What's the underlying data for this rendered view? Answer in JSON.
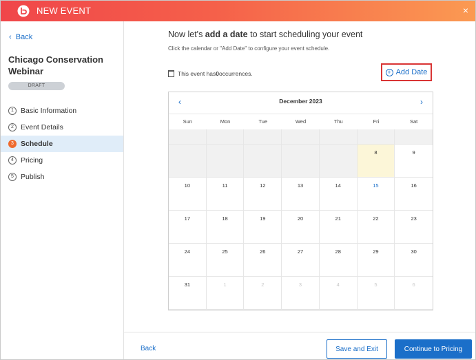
{
  "window": {
    "title": "NEW EVENT",
    "close_glyph": "×"
  },
  "sidebar": {
    "back_label": "Back",
    "event_title": "Chicago Conservation Webinar",
    "status_badge": "DRAFT",
    "steps": [
      {
        "num": "1",
        "label": "Basic Information",
        "active": false
      },
      {
        "num": "2",
        "label": "Event Details",
        "active": false
      },
      {
        "num": "3",
        "label": "Schedule",
        "active": true
      },
      {
        "num": "4",
        "label": "Pricing",
        "active": false
      },
      {
        "num": "5",
        "label": "Publish",
        "active": false
      }
    ]
  },
  "main": {
    "headline_prefix": "Now let's ",
    "headline_bold": "add a date",
    "headline_suffix": " to start scheduling your event",
    "subline": "Click the calendar or \"Add Date\" to configure your event schedule.",
    "occ_prefix": "This event has ",
    "occ_count": "0",
    "occ_suffix": " occurrences.",
    "add_date_label": "Add Date"
  },
  "calendar": {
    "month_label": "December 2023",
    "prev_glyph": "‹",
    "next_glyph": "›",
    "weekdays": [
      "Sun",
      "Mon",
      "Tue",
      "Wed",
      "Thu",
      "Fri",
      "Sat"
    ],
    "weeks": [
      [
        "",
        "",
        "",
        "",
        "",
        "",
        ""
      ],
      [
        "",
        "",
        "",
        "",
        "",
        "8",
        "9"
      ],
      [
        "10",
        "11",
        "12",
        "13",
        "14",
        "15",
        "16"
      ],
      [
        "17",
        "18",
        "19",
        "20",
        "21",
        "22",
        "23"
      ],
      [
        "24",
        "25",
        "26",
        "27",
        "28",
        "29",
        "30"
      ],
      [
        "31",
        "1",
        "2",
        "3",
        "4",
        "5",
        "6"
      ]
    ],
    "today": "8",
    "highlight_day": "15"
  },
  "footer": {
    "back_label": "Back",
    "save_exit_label": "Save and Exit",
    "continue_label": "Continue to Pricing"
  },
  "colors": {
    "accent_blue": "#1b6fc9",
    "active_step": "#ef6a2e",
    "add_date_border": "#d93434"
  }
}
